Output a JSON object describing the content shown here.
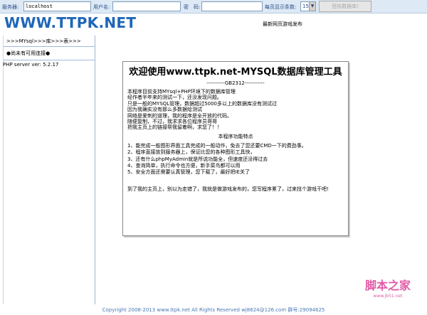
{
  "topbar": {
    "server_label": "服务器:",
    "server_value": "localhost",
    "user_label": "用户名:",
    "password_label": "密　码:",
    "per_page_label": "每页显示条数:",
    "per_page_value": "15",
    "connect_button": "登陆数据库!"
  },
  "header": {
    "logo": "WWW.TTPK.NET",
    "headline": "最新网页游戏发布"
  },
  "sidebar": {
    "breadcrumb": ">>>MYsql>>>库>>>表>>>",
    "message": "●尚未有可用连接●"
  },
  "server_version": "PHP server ver: 5.2.17",
  "content": {
    "title": "欢迎使用www.ttpk.net-MYSQL数据库管理工具",
    "charset": "----------GB2312-----------",
    "intro_lines": [
      "本程序目前支持MYsql+PHP环境下的数据库管理",
      "经作者半年来的测试一下，还没发现问题。",
      "只是一般的MYSQL管理，数据超过5000多以上的数据库没有测试过",
      "因为我确实没有那么多数据给测试",
      "网络是爱刺的道理，我的程序是全开放的代码。",
      "随便复制，不过，我求求各位程序员哥哥",
      "把我主页上的链接帮我留着啊，求您了！！"
    ],
    "features_title": "本程序功能特点",
    "features": [
      "1、能完成一般图形界面工具完成的一般动作，免去了您还要CMD一下的费劲事。",
      "2、程序直接放到服务器上，保证比您的各种图形工具快，",
      "3、还有什么phpMyAdmin就是所说功能全，但速度还没得过去",
      "4、查询简单，执行命令也方便，新手菜鸟都可以用",
      "5、安全方面还需要认真管理，您下载了，最好把IE关了"
    ],
    "homepage_note": "到了我的主页上，别以为走错了，我就是做游戏发布的，您写程序累了，过来找个游戏干吧!"
  },
  "footer": "Copyright 2008-2013 www.ttpk.net All Rights Reserved wj8624@126.com 群号:29094625",
  "watermark": {
    "cn": "脚本之家",
    "url": "www.jb51.net"
  },
  "colors": {
    "logo": "#1f66b8",
    "footer": "#4a78b4",
    "topbar": "#dde9f5",
    "watermark": "#e25aa7"
  }
}
